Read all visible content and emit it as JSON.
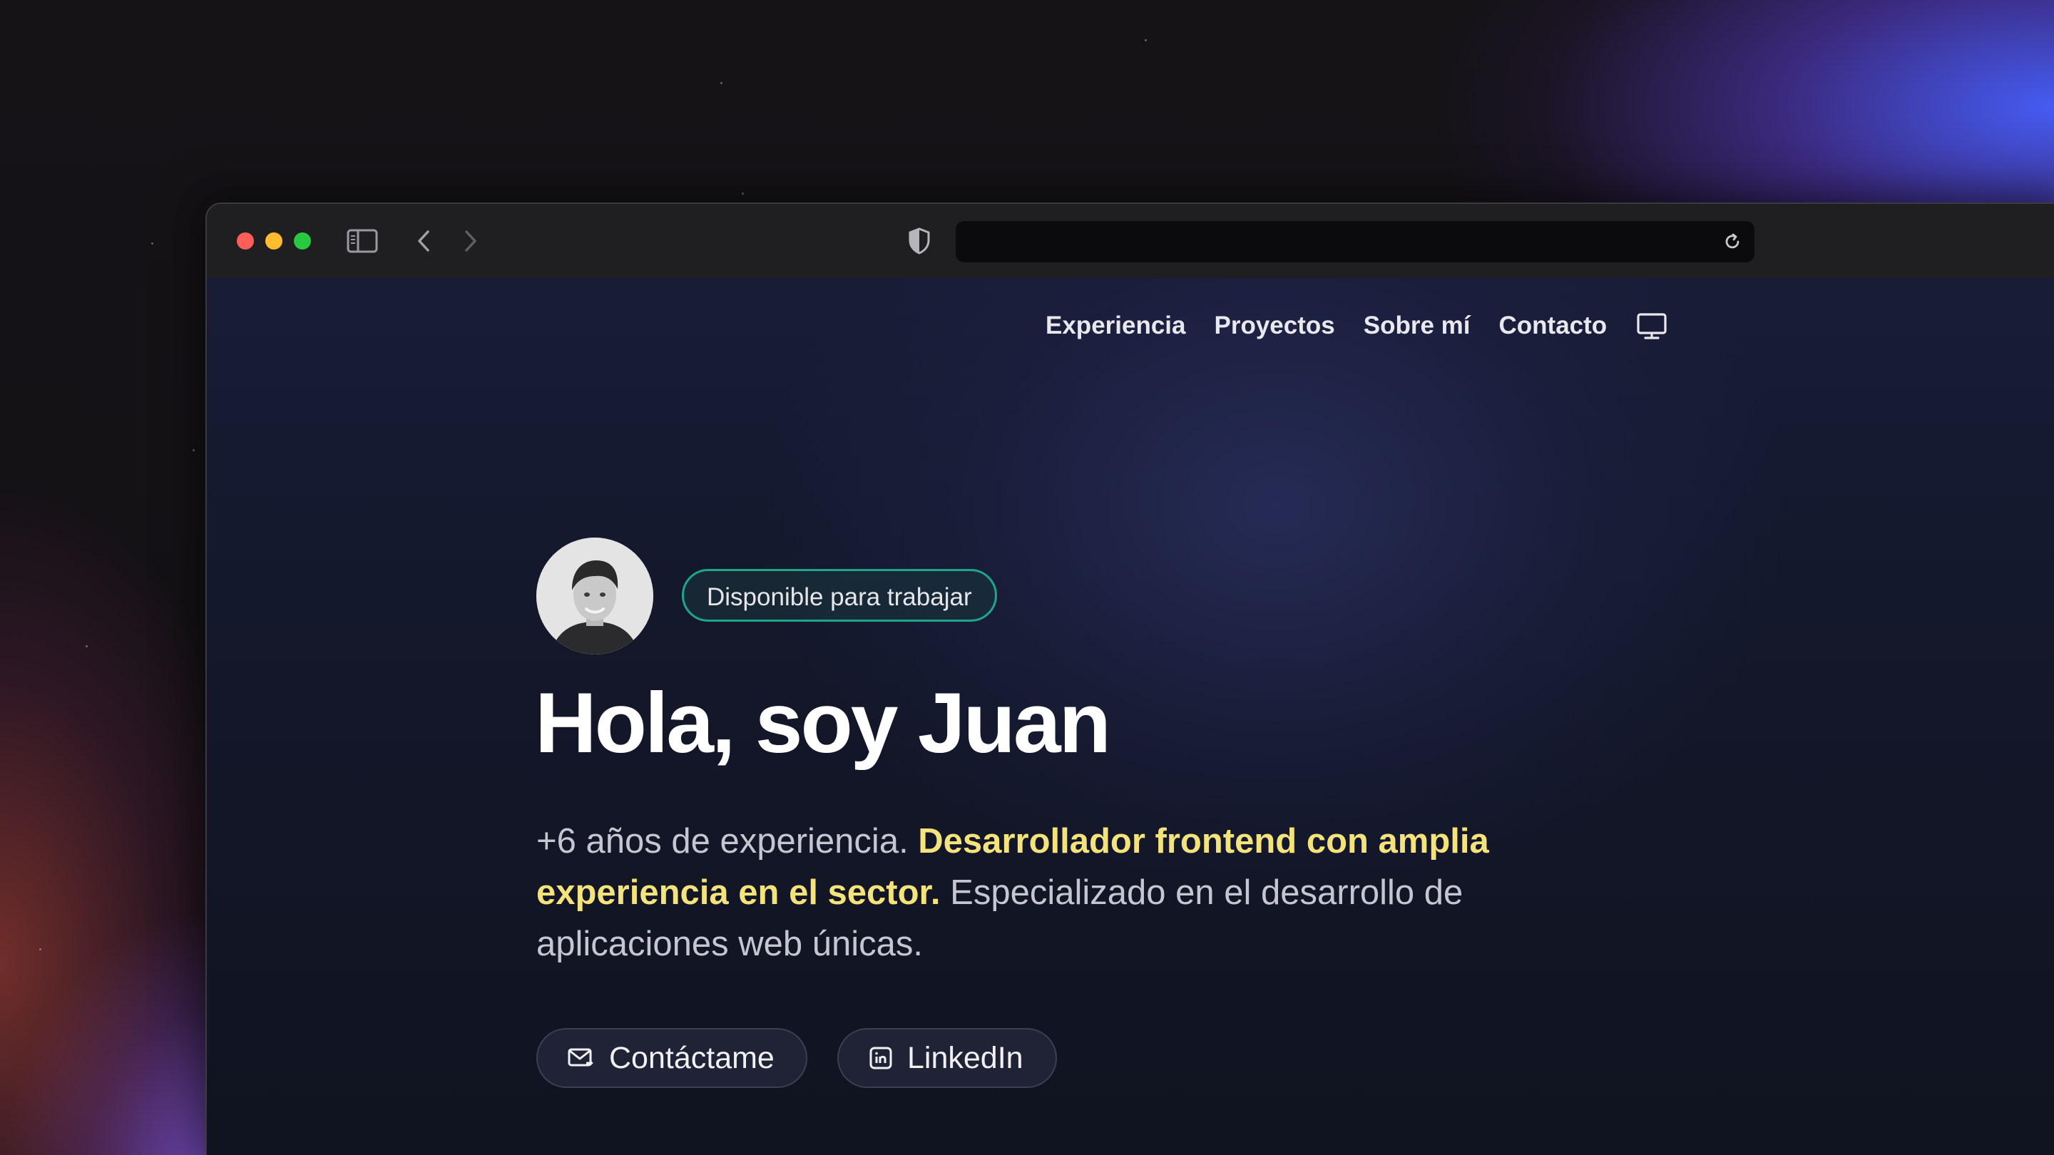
{
  "browser": {
    "url": "",
    "traffic_lights": {
      "close": "#ff5f57",
      "minimize": "#febc2e",
      "maximize": "#28c840"
    }
  },
  "nav": {
    "items": [
      "Experiencia",
      "Proyectos",
      "Sobre mí",
      "Contacto"
    ],
    "theme_icon": "monitor-icon"
  },
  "hero": {
    "badge": "Disponible para trabajar",
    "title": "Hola, soy Juan",
    "desc_part1": "+6 años de experiencia. ",
    "desc_highlight": "Desarrollador frontend con amplia experiencia en el sector.",
    "desc_part2": " Especializado en el desarrollo de aplicaciones web únicas."
  },
  "buttons": {
    "contact": "Contáctame",
    "linkedin": "LinkedIn",
    "contact_icon": "mail-icon",
    "linkedin_icon": "linkedin-icon"
  },
  "colors": {
    "highlight": "#f4e27a",
    "badge_border": "#1fa58a",
    "page_bg": "#131729"
  }
}
